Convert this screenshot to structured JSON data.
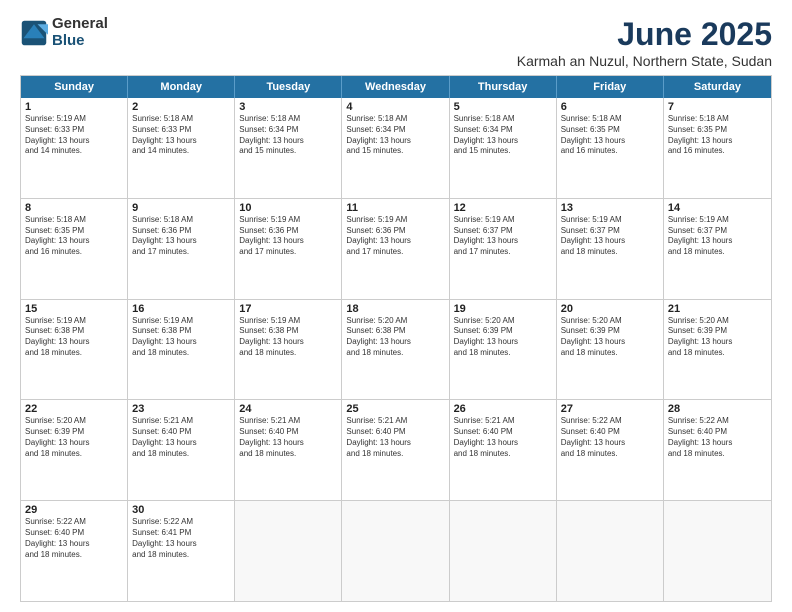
{
  "logo": {
    "general": "General",
    "blue": "Blue"
  },
  "title": "June 2025",
  "subtitle": "Karmah an Nuzul, Northern State, Sudan",
  "header_days": [
    "Sunday",
    "Monday",
    "Tuesday",
    "Wednesday",
    "Thursday",
    "Friday",
    "Saturday"
  ],
  "rows": [
    [
      {
        "day": "1",
        "info": "Sunrise: 5:19 AM\nSunset: 6:33 PM\nDaylight: 13 hours\nand 14 minutes."
      },
      {
        "day": "2",
        "info": "Sunrise: 5:18 AM\nSunset: 6:33 PM\nDaylight: 13 hours\nand 14 minutes."
      },
      {
        "day": "3",
        "info": "Sunrise: 5:18 AM\nSunset: 6:34 PM\nDaylight: 13 hours\nand 15 minutes."
      },
      {
        "day": "4",
        "info": "Sunrise: 5:18 AM\nSunset: 6:34 PM\nDaylight: 13 hours\nand 15 minutes."
      },
      {
        "day": "5",
        "info": "Sunrise: 5:18 AM\nSunset: 6:34 PM\nDaylight: 13 hours\nand 15 minutes."
      },
      {
        "day": "6",
        "info": "Sunrise: 5:18 AM\nSunset: 6:35 PM\nDaylight: 13 hours\nand 16 minutes."
      },
      {
        "day": "7",
        "info": "Sunrise: 5:18 AM\nSunset: 6:35 PM\nDaylight: 13 hours\nand 16 minutes."
      }
    ],
    [
      {
        "day": "8",
        "info": "Sunrise: 5:18 AM\nSunset: 6:35 PM\nDaylight: 13 hours\nand 16 minutes."
      },
      {
        "day": "9",
        "info": "Sunrise: 5:18 AM\nSunset: 6:36 PM\nDaylight: 13 hours\nand 17 minutes."
      },
      {
        "day": "10",
        "info": "Sunrise: 5:19 AM\nSunset: 6:36 PM\nDaylight: 13 hours\nand 17 minutes."
      },
      {
        "day": "11",
        "info": "Sunrise: 5:19 AM\nSunset: 6:36 PM\nDaylight: 13 hours\nand 17 minutes."
      },
      {
        "day": "12",
        "info": "Sunrise: 5:19 AM\nSunset: 6:37 PM\nDaylight: 13 hours\nand 17 minutes."
      },
      {
        "day": "13",
        "info": "Sunrise: 5:19 AM\nSunset: 6:37 PM\nDaylight: 13 hours\nand 18 minutes."
      },
      {
        "day": "14",
        "info": "Sunrise: 5:19 AM\nSunset: 6:37 PM\nDaylight: 13 hours\nand 18 minutes."
      }
    ],
    [
      {
        "day": "15",
        "info": "Sunrise: 5:19 AM\nSunset: 6:38 PM\nDaylight: 13 hours\nand 18 minutes."
      },
      {
        "day": "16",
        "info": "Sunrise: 5:19 AM\nSunset: 6:38 PM\nDaylight: 13 hours\nand 18 minutes."
      },
      {
        "day": "17",
        "info": "Sunrise: 5:19 AM\nSunset: 6:38 PM\nDaylight: 13 hours\nand 18 minutes."
      },
      {
        "day": "18",
        "info": "Sunrise: 5:20 AM\nSunset: 6:38 PM\nDaylight: 13 hours\nand 18 minutes."
      },
      {
        "day": "19",
        "info": "Sunrise: 5:20 AM\nSunset: 6:39 PM\nDaylight: 13 hours\nand 18 minutes."
      },
      {
        "day": "20",
        "info": "Sunrise: 5:20 AM\nSunset: 6:39 PM\nDaylight: 13 hours\nand 18 minutes."
      },
      {
        "day": "21",
        "info": "Sunrise: 5:20 AM\nSunset: 6:39 PM\nDaylight: 13 hours\nand 18 minutes."
      }
    ],
    [
      {
        "day": "22",
        "info": "Sunrise: 5:20 AM\nSunset: 6:39 PM\nDaylight: 13 hours\nand 18 minutes."
      },
      {
        "day": "23",
        "info": "Sunrise: 5:21 AM\nSunset: 6:40 PM\nDaylight: 13 hours\nand 18 minutes."
      },
      {
        "day": "24",
        "info": "Sunrise: 5:21 AM\nSunset: 6:40 PM\nDaylight: 13 hours\nand 18 minutes."
      },
      {
        "day": "25",
        "info": "Sunrise: 5:21 AM\nSunset: 6:40 PM\nDaylight: 13 hours\nand 18 minutes."
      },
      {
        "day": "26",
        "info": "Sunrise: 5:21 AM\nSunset: 6:40 PM\nDaylight: 13 hours\nand 18 minutes."
      },
      {
        "day": "27",
        "info": "Sunrise: 5:22 AM\nSunset: 6:40 PM\nDaylight: 13 hours\nand 18 minutes."
      },
      {
        "day": "28",
        "info": "Sunrise: 5:22 AM\nSunset: 6:40 PM\nDaylight: 13 hours\nand 18 minutes."
      }
    ],
    [
      {
        "day": "29",
        "info": "Sunrise: 5:22 AM\nSunset: 6:40 PM\nDaylight: 13 hours\nand 18 minutes."
      },
      {
        "day": "30",
        "info": "Sunrise: 5:22 AM\nSunset: 6:41 PM\nDaylight: 13 hours\nand 18 minutes."
      },
      {
        "day": "",
        "info": ""
      },
      {
        "day": "",
        "info": ""
      },
      {
        "day": "",
        "info": ""
      },
      {
        "day": "",
        "info": ""
      },
      {
        "day": "",
        "info": ""
      }
    ]
  ]
}
